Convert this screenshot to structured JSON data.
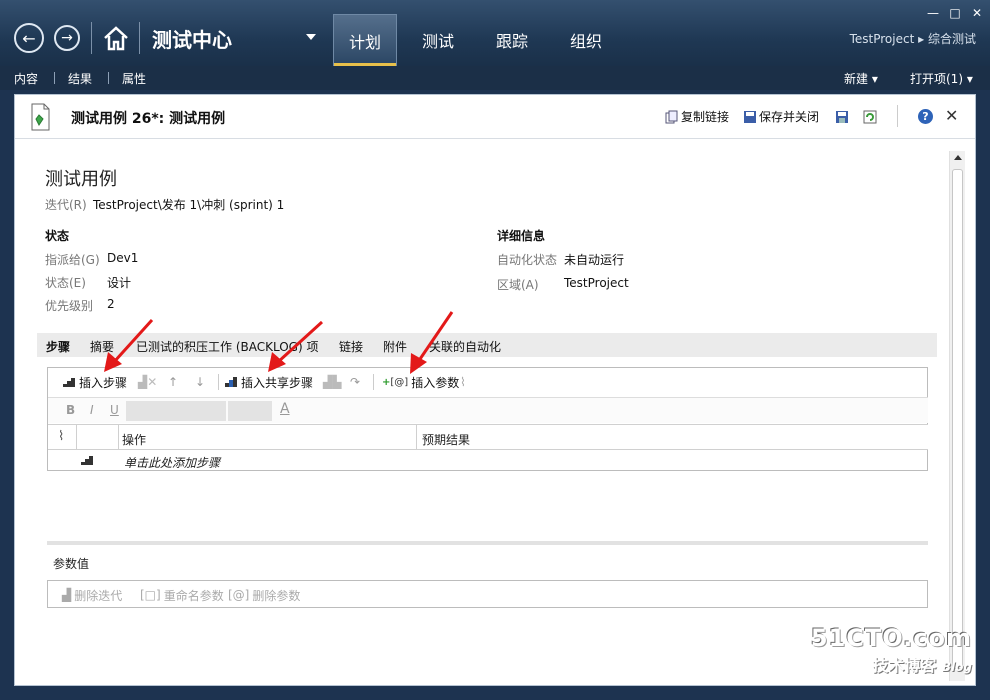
{
  "app": {
    "title": "测试中心"
  },
  "tabs": [
    "计划",
    "测试",
    "跟踪",
    "组织"
  ],
  "breadcrumb": {
    "project": "TestProject",
    "sep": "▸",
    "page": "综合测试"
  },
  "subnav": {
    "items": [
      "内容",
      "结果",
      "属性"
    ],
    "new_label": "新建",
    "open_label": "打开项(1)"
  },
  "window_controls": {
    "min": "—",
    "max": "□",
    "close": "✕"
  },
  "panel": {
    "title": "测试用例 26*: 测试用例",
    "copy_link": "复制链接",
    "save_close": "保存并关闭",
    "help": "?",
    "close": "✕"
  },
  "form": {
    "heading": "测试用例",
    "iteration_label": "迭代(R)",
    "iteration_value": "TestProject\\发布 1\\冲刺 (sprint) 1",
    "status_section": "状态",
    "assigned_label": "指派给(G)",
    "assigned_value": "Dev1",
    "state_label": "状态(E)",
    "state_value": "设计",
    "priority_label": "优先级别",
    "priority_value": "2",
    "details_section": "详细信息",
    "automation_label": "自动化状态",
    "automation_value": "未自动运行",
    "area_label": "区域(A)",
    "area_value": "TestProject"
  },
  "detail_tabs": [
    "步骤",
    "摘要",
    "已测试的积压工作 (BACKLOG) 项",
    "链接",
    "附件",
    "关联的自动化"
  ],
  "steps_toolbar": {
    "insert_step": "插入步骤",
    "insert_shared": "插入共享步骤",
    "insert_param": "插入参数"
  },
  "format_toolbar": {
    "bold": "B",
    "italic": "I",
    "underline": "U",
    "font_color": "A"
  },
  "steps_grid": {
    "columns": [
      "操作",
      "预期结果"
    ],
    "add_hint": "单击此处添加步骤"
  },
  "params": {
    "title": "参数值",
    "delete_iter": "删除迭代",
    "rename_param": "重命名参数",
    "delete_param": "删除参数"
  },
  "watermark": {
    "site": "51CTO.com",
    "sub": "技术博客",
    "blog": "Blog"
  },
  "colors": {
    "accent": "#e8c04a",
    "header_bg": "#1f3854",
    "arrow": "#e31919"
  }
}
